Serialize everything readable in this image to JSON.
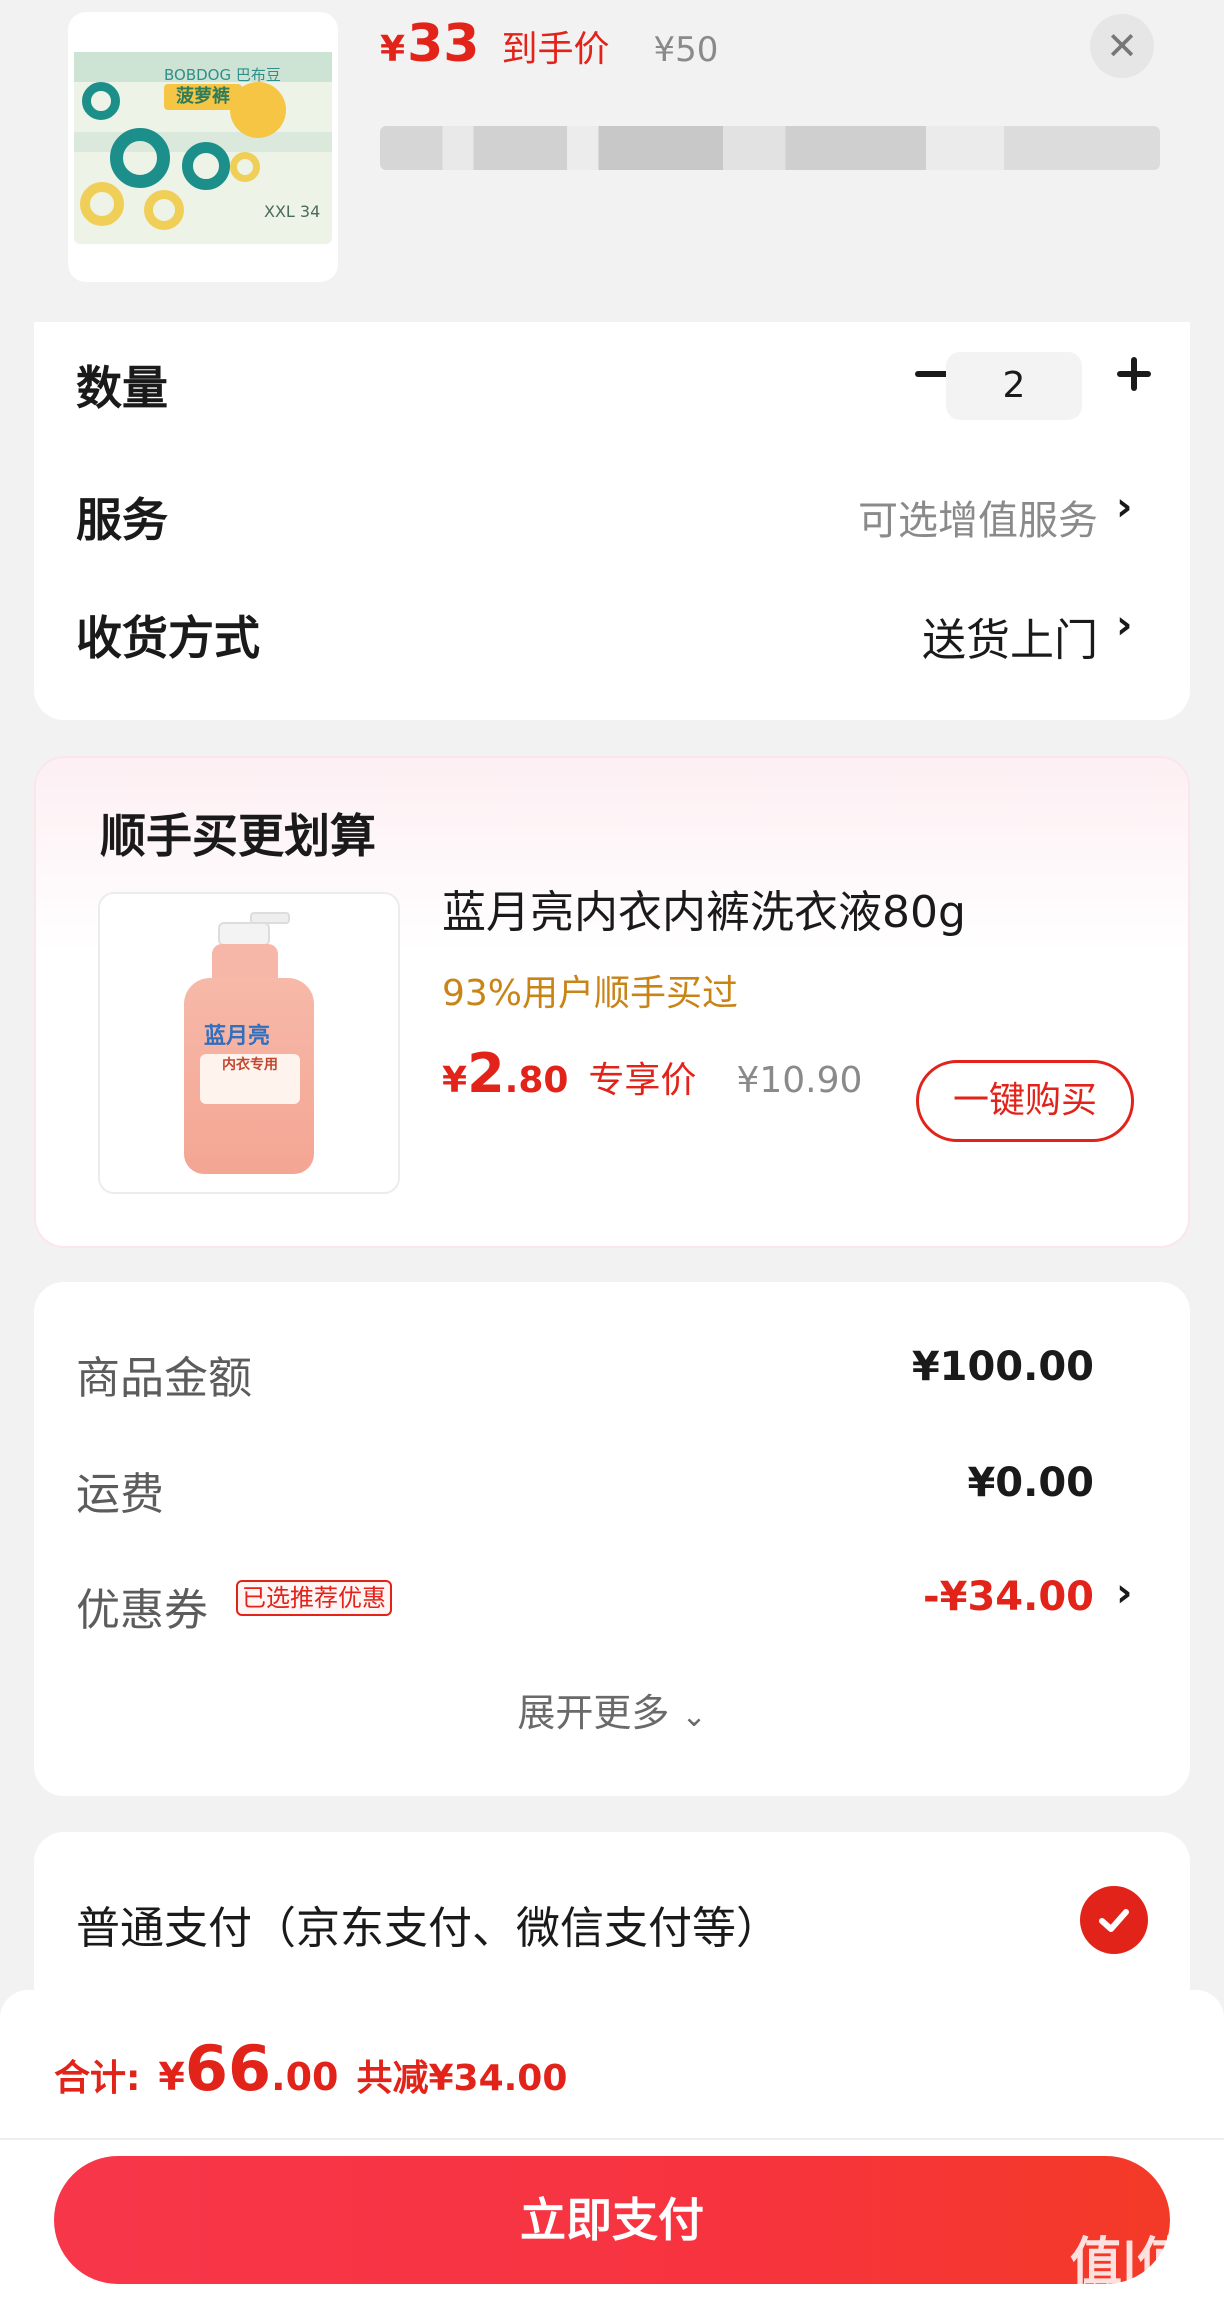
{
  "header": {
    "price_yen": "¥",
    "price": "33",
    "price_tag": "到手价",
    "original_price": "¥50",
    "close_icon": "close-icon",
    "product_brand": "BOBDOG 巴布豆",
    "product_name": "菠萝裤",
    "product_size": "XXL 34"
  },
  "options": {
    "quantity_label": "数量",
    "quantity_value": "2",
    "service_label": "服务",
    "service_value": "可选增值服务",
    "delivery_label": "收货方式",
    "delivery_value": "送货上门"
  },
  "upsell": {
    "title": "顺手买更划算",
    "product_name": "蓝月亮内衣内裤洗衣液80g",
    "subtitle": "93%用户顺手买过",
    "price_yen": "¥",
    "price_int": "2",
    "price_dec": ".80",
    "price_tag": "专享价",
    "original_price": "¥10.90",
    "button_label": "一键购买",
    "bottle_brand": "蓝月亮",
    "bottle_label": "内衣专用"
  },
  "summary": {
    "goods_label": "商品金额",
    "goods_value": "¥100.00",
    "shipping_label": "运费",
    "shipping_value": "¥0.00",
    "coupon_label": "优惠券",
    "coupon_badge": "已选推荐优惠",
    "coupon_value": "-¥34.00",
    "expand_label": "展开更多"
  },
  "payment": {
    "method_label": "普通支付（京东支付、微信支付等）",
    "selected": true
  },
  "footer": {
    "total_label": "合计:",
    "total_yen": "¥",
    "total_int": "66",
    "total_dec": ".00",
    "saved_label": "共减¥34.00",
    "pay_button": "立即支付",
    "watermark": "值|值|值",
    "watermark_url": "zhizhizhi.com"
  },
  "colors": {
    "accent_red": "#e2231a",
    "gold": "#c98418",
    "background": "#f2f2f2"
  }
}
